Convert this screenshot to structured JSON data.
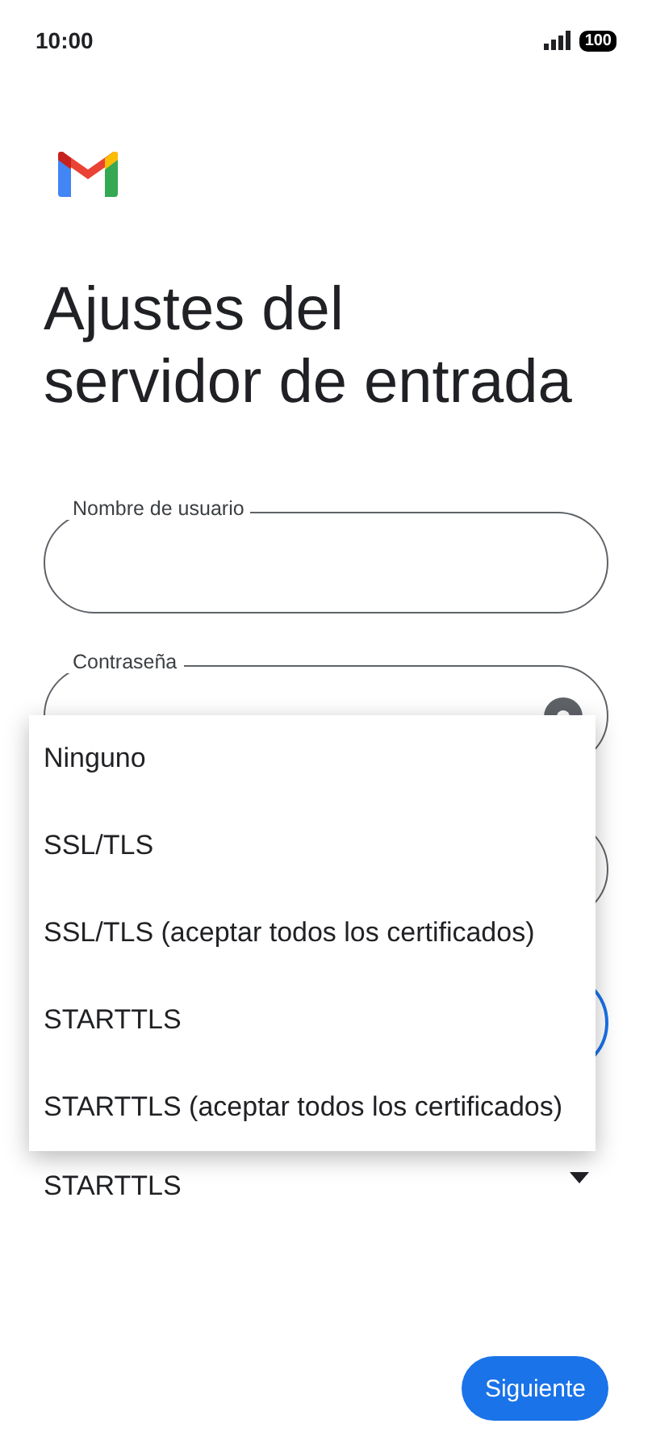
{
  "status_bar": {
    "time": "10:00",
    "battery": "100"
  },
  "title": "Ajustes del\nservidor de entrada",
  "fields": [
    {
      "label": "Nombre de usuario",
      "kind": "text",
      "focused": false
    },
    {
      "label": "Contraseña",
      "kind": "password",
      "focused": false
    },
    {
      "kind": "text",
      "focused": false
    },
    {
      "kind": "text",
      "focused": true
    }
  ],
  "security": {
    "value": "STARTTLS"
  },
  "menu": {
    "options": [
      "Ninguno",
      "SSL/TLS",
      "SSL/TLS (aceptar todos los certificados)",
      "STARTTLS",
      "STARTTLS (aceptar todos los certificados)"
    ]
  },
  "next_button": "Siguiente"
}
